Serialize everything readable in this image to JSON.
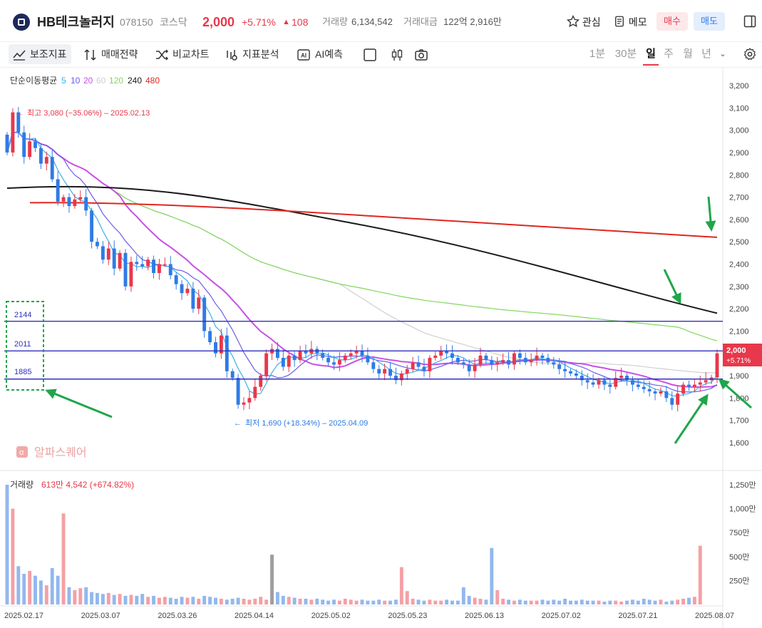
{
  "header": {
    "name": "HB테크놀러지",
    "code": "078150",
    "market": "코스닥",
    "price": "2,000",
    "change_pct": "+5.71%",
    "change_amt": "108",
    "volume_label": "거래량",
    "volume_value": "6,134,542",
    "amount_label": "거래대금",
    "amount_value": "122억 2,916만",
    "watch_label": "관심",
    "memo_label": "메모",
    "buy_label": "매수",
    "sell_label": "매도"
  },
  "toolbar": {
    "indicator_label": "보조지표",
    "strategy_label": "매매전략",
    "compare_label": "비교차트",
    "analysis_label": "지표분석",
    "ai_label": "AI예측",
    "periods": [
      "1분",
      "30분",
      "일",
      "주",
      "월",
      "년"
    ],
    "active_period": "일"
  },
  "colors": {
    "up": "#e8384b",
    "down": "#2e7be6",
    "ma5": "#3ab0e8",
    "ma10": "#6c5ce7",
    "ma20": "#c94fe6",
    "ma60": "#cfcfcf",
    "ma120": "#7fd85c",
    "ma240": "#1a1a1a",
    "ma480": "#e0271f",
    "hline": "#3030c0",
    "arrow": "#1fa64a"
  },
  "legend": {
    "title": "단순이동평균",
    "items": [
      {
        "label": "5",
        "color": "#3ab0e8"
      },
      {
        "label": "10",
        "color": "#6c5ce7"
      },
      {
        "label": "20",
        "color": "#c94fe6"
      },
      {
        "label": "60",
        "color": "#cfcfcf"
      },
      {
        "label": "120",
        "color": "#7fd85c"
      },
      {
        "label": "240",
        "color": "#1a1a1a"
      },
      {
        "label": "480",
        "color": "#e0271f"
      }
    ]
  },
  "annotations": {
    "high": "최고 3,080 (−35.06%) – 2025.02.13",
    "low": "최저 1,690 (+18.34%) – 2025.04.09",
    "price_tag": "2,000",
    "price_tag_pct": "+5.71%",
    "volume_info_label": "거래량",
    "volume_info_value": "613만 4,542 (+674.82%)",
    "watermark": "알파스퀘어",
    "levels": [
      "2144",
      "2011",
      "1885"
    ]
  },
  "chart_data": {
    "type": "candlestick",
    "y_ticks": [
      1600,
      1700,
      1800,
      1900,
      2000,
      2100,
      2200,
      2300,
      2400,
      2500,
      2600,
      2700,
      2800,
      2900,
      3000,
      3100,
      3200
    ],
    "y_tick_labels": [
      "1,600",
      "1,700",
      "1,800",
      "1,900",
      "2,000",
      "2,100",
      "2,200",
      "2,300",
      "2,400",
      "2,500",
      "2,600",
      "2,700",
      "2,800",
      "2,900",
      "3,000",
      "3,100",
      "3,200"
    ],
    "vol_ticks": [
      250,
      500,
      750,
      1000,
      1250
    ],
    "vol_tick_labels": [
      "250만",
      "500만",
      "750만",
      "1,000만",
      "1,250만"
    ],
    "x_labels": [
      "2025.02.17",
      "2025.03.07",
      "2025.03.26",
      "2025.04.14",
      "2025.05.02",
      "2025.05.23",
      "2025.06.13",
      "2025.07.02",
      "2025.07.21",
      "2025.08.07"
    ],
    "horizontal_levels": [
      2144,
      2011,
      1885
    ],
    "ohlc_close": [
      2900,
      3080,
      2990,
      2880,
      2950,
      2920,
      2850,
      2880,
      2780,
      2680,
      2700,
      2660,
      2690,
      2700,
      2640,
      2500,
      2480,
      2420,
      2470,
      2380,
      2450,
      2300,
      2410,
      2400,
      2390,
      2420,
      2360,
      2400,
      2400,
      2350,
      2310,
      2270,
      2290,
      2200,
      2250,
      2100,
      2050,
      2000,
      2080,
      1920,
      1890,
      1770,
      1780,
      1800,
      1850,
      1900,
      2000,
      2020,
      1980,
      1940,
      1990,
      1970,
      2010,
      2000,
      2020,
      2000,
      1980,
      1960,
      1950,
      1970,
      1990,
      2000,
      2010,
      1990,
      1960,
      1930,
      1910,
      1930,
      1900,
      1880,
      1910,
      1930,
      1960,
      1940,
      1920,
      1980,
      1990,
      2010,
      2000,
      1980,
      1960,
      1950,
      1920,
      1950,
      1990,
      1970,
      1950,
      1960,
      1970,
      1950,
      2000,
      1980,
      1960,
      1970,
      1990,
      1980,
      1960,
      1950,
      1930,
      1920,
      1910,
      1900,
      1880,
      1870,
      1860,
      1880,
      1860,
      1850,
      1890,
      1900,
      1880,
      1860,
      1850,
      1840,
      1830,
      1820,
      1830,
      1800,
      1770,
      1820,
      1860,
      1850,
      1860,
      1870,
      1880,
      1892,
      2000
    ],
    "volume_man": [
      1250,
      1000,
      400,
      320,
      350,
      300,
      250,
      200,
      380,
      300,
      950,
      180,
      150,
      170,
      180,
      130,
      120,
      110,
      120,
      100,
      110,
      90,
      100,
      90,
      110,
      80,
      90,
      70,
      80,
      70,
      60,
      80,
      70,
      80,
      60,
      90,
      80,
      70,
      60,
      50,
      60,
      70,
      60,
      50,
      60,
      80,
      50,
      520,
      130,
      90,
      80,
      70,
      60,
      60,
      50,
      60,
      50,
      40,
      50,
      40,
      60,
      50,
      40,
      50,
      40,
      40,
      50,
      40,
      40,
      50,
      390,
      140,
      60,
      50,
      40,
      50,
      40,
      40,
      50,
      40,
      40,
      180,
      90,
      70,
      60,
      50,
      590,
      150,
      60,
      50,
      40,
      50,
      40,
      40,
      40,
      50,
      40,
      50,
      40,
      60,
      40,
      40,
      50,
      40,
      40,
      40,
      30,
      40,
      40,
      30,
      40,
      50,
      40,
      60,
      50,
      40,
      50,
      30,
      40,
      50,
      60,
      70,
      80,
      613
    ]
  }
}
